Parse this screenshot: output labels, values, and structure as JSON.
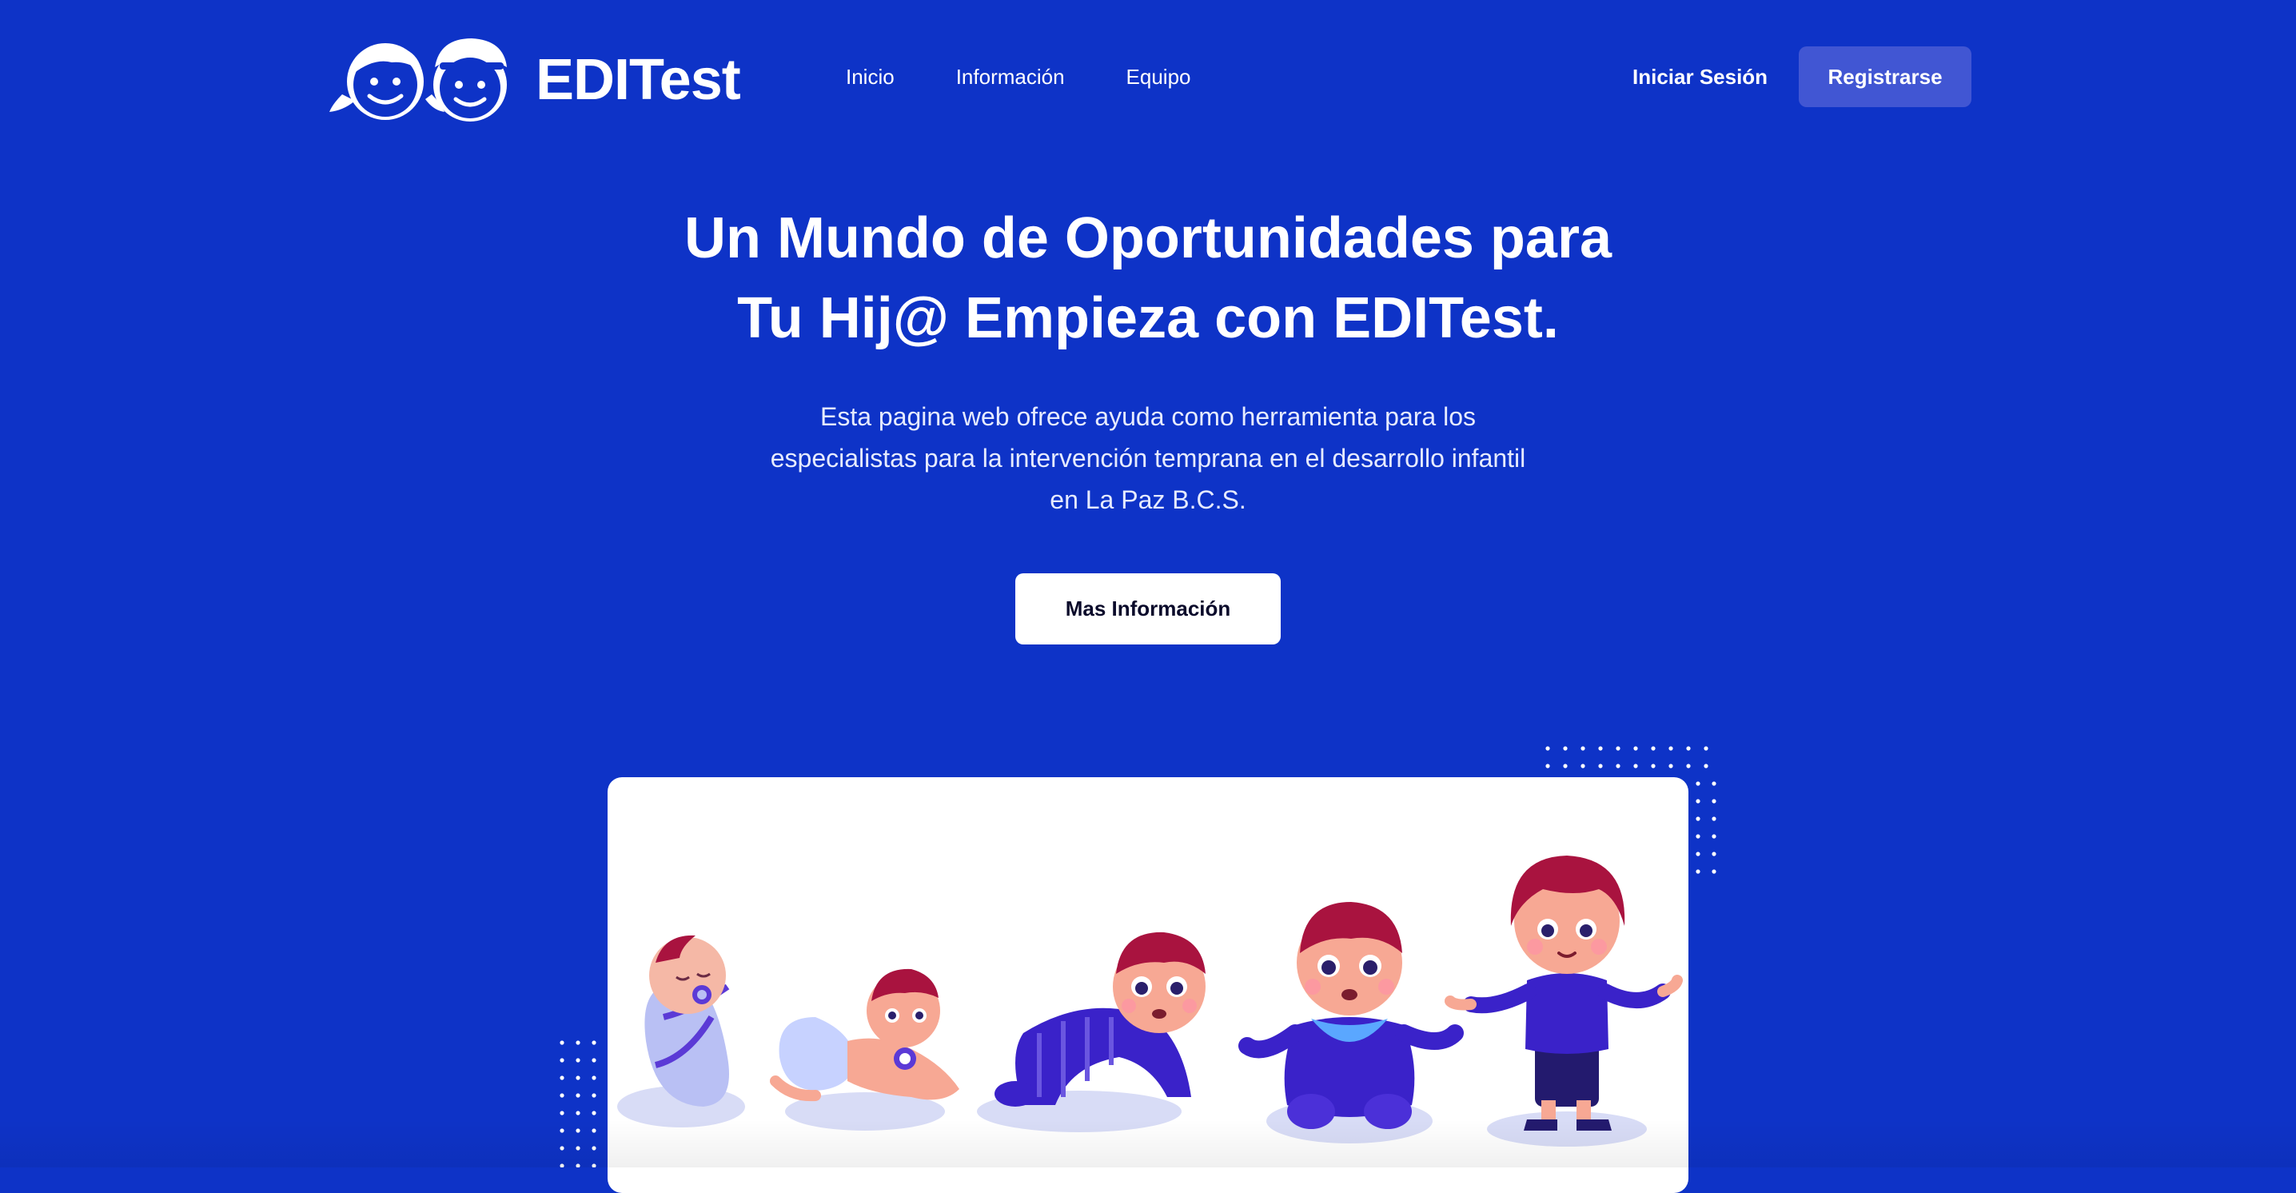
{
  "brand": {
    "name": "EDITest",
    "logo_icon": "two-kids-faces-icon",
    "primary_color": "#0e33c7",
    "button_accent": "#4156d3"
  },
  "nav": {
    "items": [
      {
        "label": "Inicio"
      },
      {
        "label": "Información"
      },
      {
        "label": "Equipo"
      }
    ]
  },
  "auth": {
    "login_label": "Iniciar Sesión",
    "register_label": "Registrarse"
  },
  "hero": {
    "title_line1": "Un Mundo de Oportunidades para",
    "title_line2": "Tu Hij@ Empieza con EDITest.",
    "subtitle": "Esta pagina web ofrece ayuda como herramienta para los especialistas para la intervención temprana en el desarrollo infantil en La Paz B.C.S.",
    "cta_label": "Mas Información"
  },
  "illustration": {
    "subject": "baby-growth-stages-illustration",
    "stages": [
      "swaddled-baby",
      "lying-baby",
      "crawling-baby",
      "sitting-baby",
      "standing-toddler"
    ]
  }
}
